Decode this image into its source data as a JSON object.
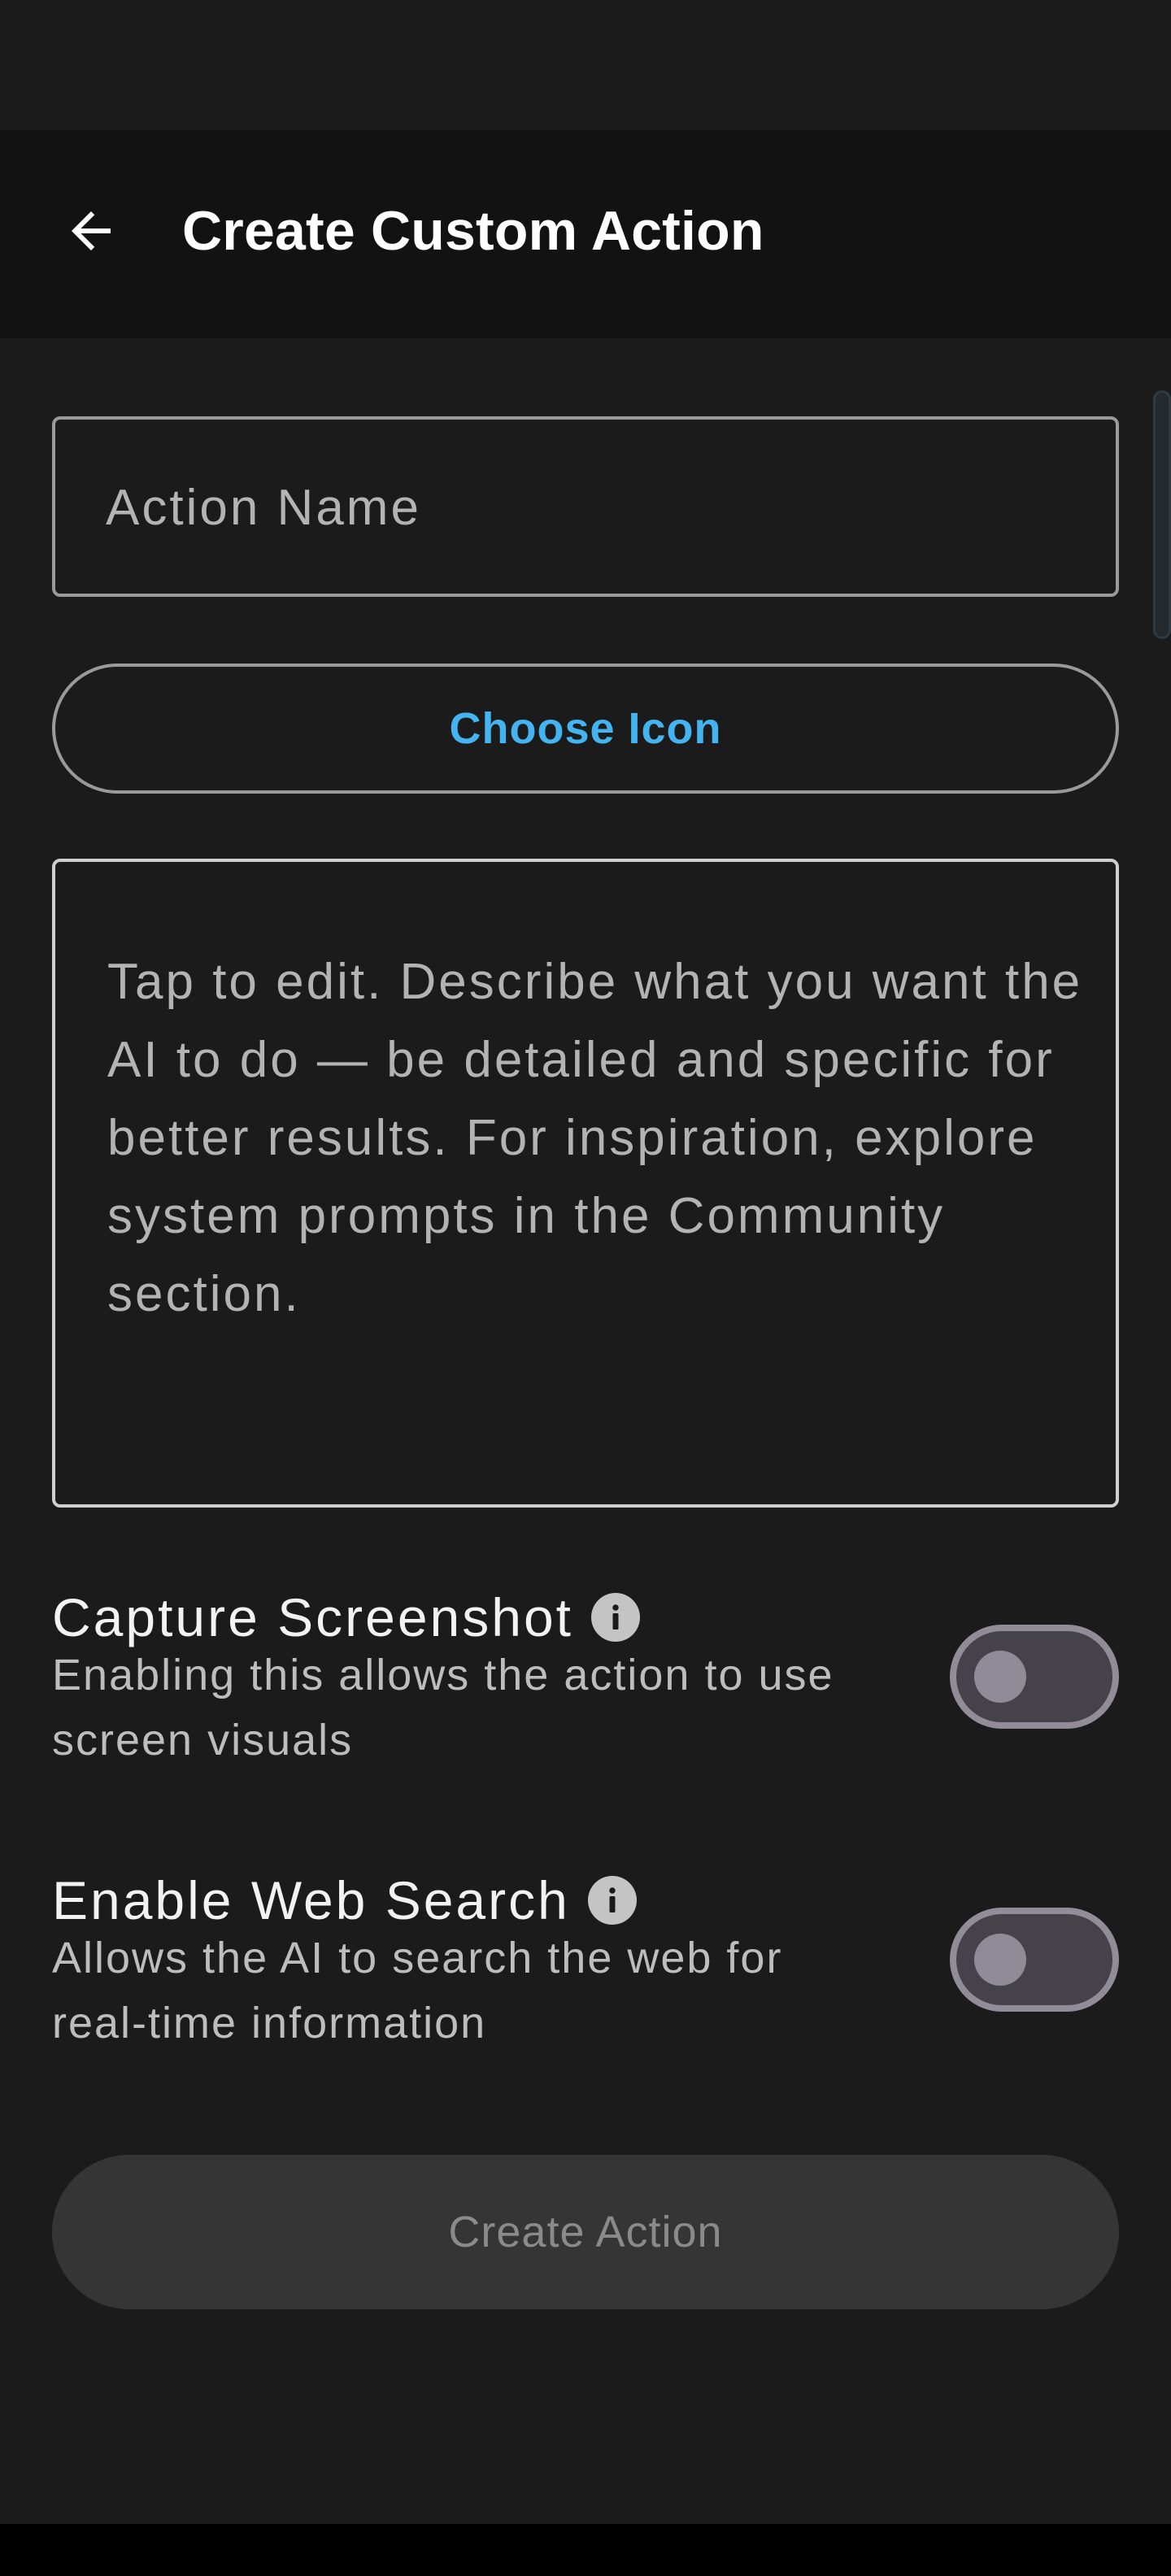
{
  "header": {
    "title": "Create Custom Action",
    "back_icon": "arrow-back-icon"
  },
  "form": {
    "name_placeholder": "Action Name",
    "choose_icon_label": "Choose Icon",
    "prompt_placeholder": "Tap to edit. Describe what you want the AI to do — be detailed and specific for better results. For inspiration, explore system prompts in the Community section."
  },
  "settings": [
    {
      "title": "Capture Screenshot",
      "description": "Enabling this allows the action to use screen visuals",
      "enabled": false
    },
    {
      "title": "Enable Web Search",
      "description": "Allows the AI to search the web for real-time information",
      "enabled": false
    }
  ],
  "actions": {
    "create_label": "Create Action"
  },
  "colors": {
    "background": "#1b1b1b",
    "app_bar": "#121212",
    "accent": "#43b4f0",
    "disabled_button": "#353535"
  }
}
